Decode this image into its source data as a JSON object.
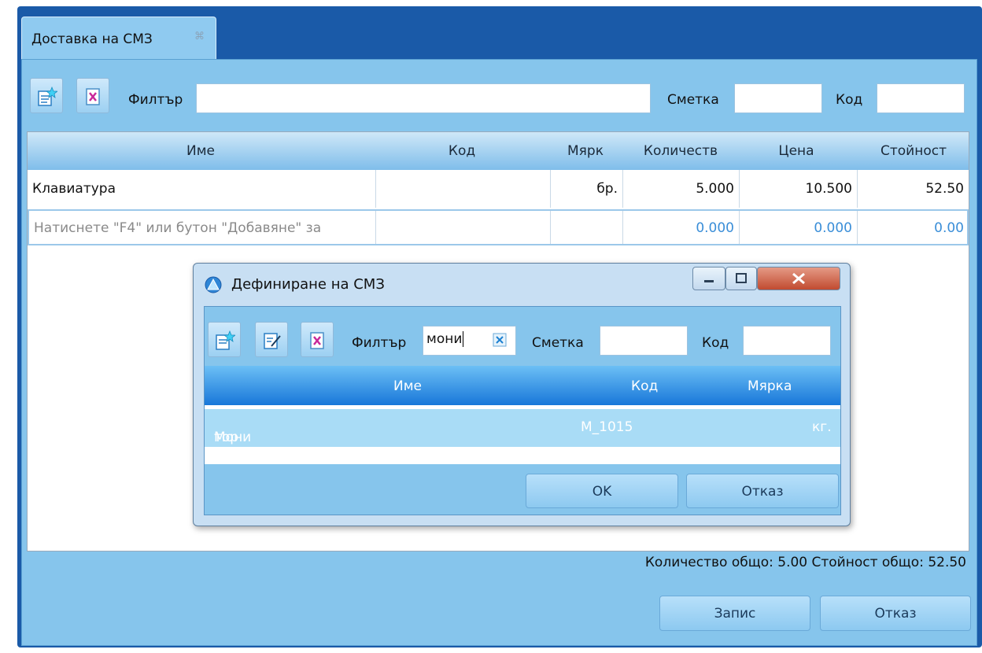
{
  "tab": {
    "title": "Доставка на СМЗ",
    "close_glyph": "⌘"
  },
  "toolbar": {
    "filter_label": "Филтър",
    "filter_value": "",
    "account_label": "Сметка",
    "account_value": "",
    "code_label": "Код",
    "code_value": ""
  },
  "grid": {
    "columns": [
      "Име",
      "Код",
      "Мярк",
      "Количеств",
      "Цена",
      "Стойност"
    ],
    "rows": [
      {
        "name": "Клавиатура",
        "code": "",
        "unit": "бр.",
        "qty": "5.000",
        "price": "10.500",
        "value": "52.50"
      }
    ],
    "new_row": {
      "hint": "Натиснете \"F4\" или бутон \"Добавяне\" за",
      "qty": "0.000",
      "price": "0.000",
      "value": "0.00"
    }
  },
  "totals": {
    "text": "Количество общо: 5.00  Стойност общо: 52.50"
  },
  "footer": {
    "save_label": "Запис",
    "cancel_label": "Отказ"
  },
  "dialog": {
    "title": "Дефиниране на СМЗ",
    "filter_label": "Филтър",
    "filter_value": "мони",
    "account_label": "Сметка",
    "account_value": "",
    "code_label": "Код",
    "code_value": "",
    "columns": [
      "Име",
      "Код",
      "Мярка"
    ],
    "selected_row": {
      "name_match": "Мони",
      "name_rest": "тор",
      "code": "М_1015",
      "unit": "кг."
    },
    "ok_label": "OK",
    "cancel_label": "Отказ"
  },
  "colors": {
    "frame": "#1a5aa8",
    "panel": "#86c5ec",
    "highlight": "#ff3d97",
    "header_blue": "#1877d9"
  }
}
